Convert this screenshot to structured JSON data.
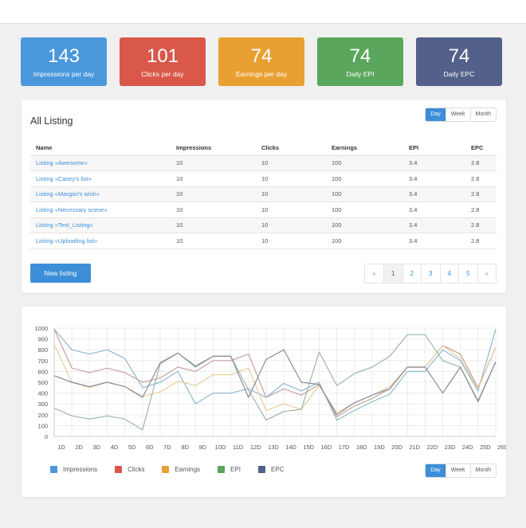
{
  "stats": [
    {
      "value": "143",
      "label": "Impressions per day",
      "color": "#4a98db"
    },
    {
      "value": "101",
      "label": "Clicks per day",
      "color": "#d9584a"
    },
    {
      "value": "74",
      "label": "Earnings per day",
      "color": "#e9a033"
    },
    {
      "value": "74",
      "label": "Daily EPI",
      "color": "#59a65c"
    },
    {
      "value": "74",
      "label": "Daily EPC",
      "color": "#536089"
    }
  ],
  "listing": {
    "title": "All Listing",
    "period_options": [
      "Day",
      "Week",
      "Month"
    ],
    "active_period": "Day",
    "columns": [
      "Name",
      "Impressions",
      "Clicks",
      "Earnings",
      "EPI",
      "EPC"
    ],
    "rows": [
      [
        "Listing «Awesome»",
        "10",
        "10",
        "100",
        "3.4",
        "2.8"
      ],
      [
        "Listing «Casey's list»",
        "10",
        "10",
        "100",
        "3.4",
        "2.8"
      ],
      [
        "Listing «Margan's wish»",
        "10",
        "10",
        "100",
        "3.4",
        "2.8"
      ],
      [
        "Listing «Necessary scene»",
        "10",
        "10",
        "100",
        "3.4",
        "2.8"
      ],
      [
        "Listing «Test_Listing»",
        "10",
        "10",
        "100",
        "3.4",
        "2.8"
      ],
      [
        "Listing «Uploading list»",
        "10",
        "10",
        "100",
        "3.4",
        "2.8"
      ]
    ],
    "new_button": "New listing",
    "pagination": [
      "«",
      "1",
      "2",
      "3",
      "4",
      "5",
      "»"
    ],
    "current_page": "1"
  },
  "chart_panel": {
    "period_options": [
      "Day",
      "Week",
      "Month"
    ],
    "active_period": "Day"
  },
  "chart_data": {
    "type": "line",
    "title": "",
    "xlabel": "",
    "ylabel": "",
    "ylim": [
      0,
      1000
    ],
    "yticks": [
      0,
      100,
      200,
      300,
      400,
      500,
      600,
      700,
      800,
      900,
      1000
    ],
    "grid": true,
    "legend_position": "bottom-left",
    "x": [
      "1D",
      "2D",
      "3D",
      "4D",
      "5D",
      "6D",
      "7D",
      "8D",
      "9D",
      "10D",
      "11D",
      "12D",
      "13D",
      "14D",
      "15D",
      "16D",
      "17D",
      "18D",
      "19D",
      "20D",
      "21D",
      "22D",
      "23D",
      "24D",
      "25D",
      "26D"
    ],
    "series": [
      {
        "name": "Impressions",
        "color": "#8fb9cf",
        "values": [
          990,
          800,
          760,
          800,
          720,
          450,
          500,
          600,
          300,
          400,
          400,
          440,
          360,
          490,
          420,
          500,
          150,
          240,
          320,
          390,
          600,
          600,
          800,
          700,
          420,
          990
        ]
      },
      {
        "name": "Clicks",
        "color": "#c9a0a0",
        "values": [
          990,
          630,
          590,
          630,
          590,
          500,
          540,
          640,
          600,
          700,
          700,
          760,
          360,
          440,
          380,
          480,
          180,
          280,
          350,
          440,
          640,
          640,
          840,
          760,
          450,
          820
        ]
      },
      {
        "name": "Earnings",
        "color": "#e6cf9a",
        "values": [
          850,
          500,
          450,
          500,
          460,
          370,
          410,
          510,
          470,
          570,
          570,
          630,
          240,
          300,
          250,
          470,
          220,
          310,
          380,
          460,
          640,
          640,
          840,
          720,
          440,
          820
        ]
      },
      {
        "name": "EPI",
        "color": "#9cb8a2",
        "values": [
          260,
          190,
          160,
          190,
          160,
          60,
          670,
          770,
          640,
          740,
          740,
          430,
          150,
          230,
          250,
          780,
          470,
          580,
          640,
          740,
          940,
          940,
          700,
          640,
          330,
          690
        ]
      },
      {
        "name": "EPC",
        "color": "#8c8c9a",
        "values": [
          560,
          500,
          460,
          500,
          460,
          360,
          680,
          770,
          650,
          740,
          740,
          360,
          710,
          800,
          500,
          480,
          200,
          310,
          380,
          440,
          640,
          640,
          400,
          640,
          320,
          690
        ]
      }
    ]
  }
}
